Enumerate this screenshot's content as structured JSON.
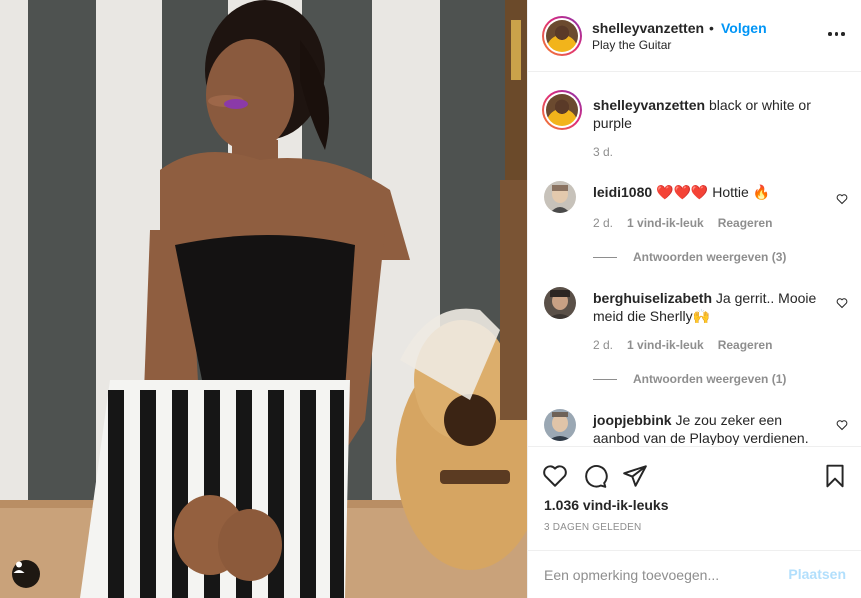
{
  "post": {
    "username": "shelleyvanzetten",
    "follow_label": "Volgen",
    "separator": "•",
    "location": "Play the Guitar",
    "caption": "black or white or purple",
    "caption_time": "3 d."
  },
  "comments": [
    {
      "username": "leidi1080",
      "text_hearts": "❤️❤️❤️",
      "text": " Hottie 🔥",
      "time": "2 d.",
      "likes": "1 vind-ik-leuk",
      "reply": "Reageren",
      "view_replies": "Antwoorden weergeven (3)"
    },
    {
      "username": "berghuiselizabeth",
      "text": "Ja gerrit.. Mooie meid die Sherlly🙌",
      "time": "2 d.",
      "likes": "1 vind-ik-leuk",
      "reply": "Reageren",
      "view_replies": "Antwoorden weergeven (1)"
    },
    {
      "username": "joopjebbink",
      "text": "Je zou zeker een aanbod van de Playboy verdienen."
    }
  ],
  "actions": {
    "likes_count": "1.036 vind-ik-leuks",
    "date": "3 DAGEN GELEDEN"
  },
  "add_comment": {
    "placeholder": "Een opmerking toevoegen...",
    "post_label": "Plaatsen"
  },
  "colors": {
    "link_blue": "#0095f6",
    "post_disabled": "#b2dffc",
    "heart_red": "#ed4956",
    "muted": "#8e8e8e"
  }
}
